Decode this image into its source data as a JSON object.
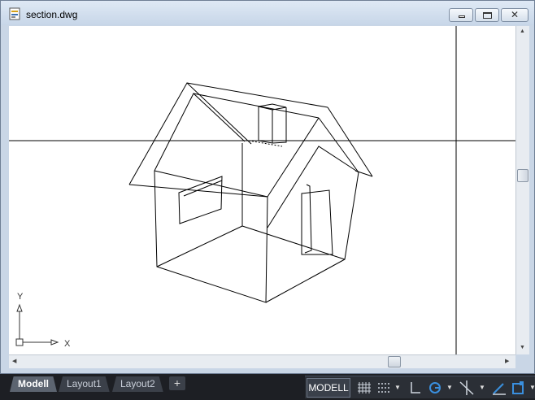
{
  "window": {
    "title": "section.dwg",
    "buttons": {
      "minimize": "minimize",
      "maximize": "maximize",
      "close": "✕"
    }
  },
  "viewport": {
    "ucs": {
      "x_label": "X",
      "y_label": "Y"
    }
  },
  "layout_tabs": [
    {
      "label": "Modell",
      "active": true
    },
    {
      "label": "Layout1",
      "active": false
    },
    {
      "label": "Layout2",
      "active": false
    }
  ],
  "add_tab_label": "+",
  "statusbar": {
    "model_label": "MODELL",
    "icons": [
      "grid-icon",
      "snap-icon",
      "ortho-icon",
      "polar-icon",
      "osnap-icon",
      "dynamic-ucs-icon",
      "selection-cycling-icon"
    ]
  },
  "colors": {
    "canvas": "#ffffff",
    "lines": "#000000",
    "statusbar": "#1d1f24",
    "accent": "#3a8fde"
  }
}
